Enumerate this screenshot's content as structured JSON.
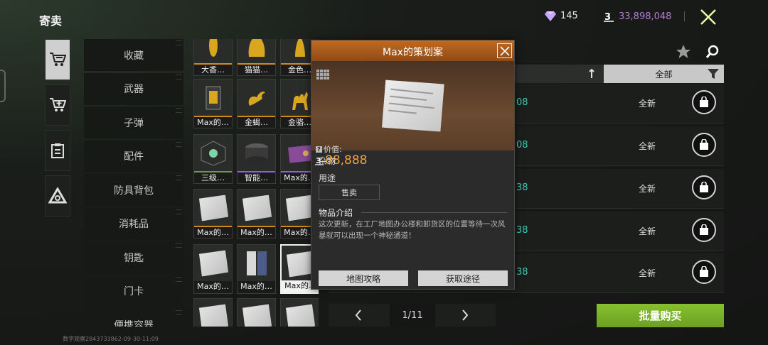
{
  "header": {
    "title": "寄卖",
    "gems": "145",
    "coins": "33,898,048"
  },
  "side_tabs": [
    {
      "icon": "cart-icon",
      "active": true
    },
    {
      "icon": "sell-cart-icon",
      "active": false
    },
    {
      "icon": "clipboard-icon",
      "active": false
    },
    {
      "icon": "triangle-icon",
      "active": false
    }
  ],
  "sub_categories": [
    "收藏",
    "武器",
    "子弹",
    "配件",
    "防具背包",
    "消耗品",
    "钥匙",
    "门卡",
    "便携容器"
  ],
  "grid_items": [
    {
      "name": "大香…",
      "rarity": "orange",
      "icon": "gold-statue-icon"
    },
    {
      "name": "猫猫…",
      "rarity": "orange",
      "icon": "gold-statue-icon"
    },
    {
      "name": "金色…",
      "rarity": "orange",
      "icon": "gold-statue-icon"
    },
    {
      "name": "Max的…",
      "rarity": "orange",
      "icon": "gold-card-icon"
    },
    {
      "name": "金蝎…",
      "rarity": "orange",
      "icon": "gold-scorpion-icon"
    },
    {
      "name": "金骆…",
      "rarity": "orange",
      "icon": "gold-camel-icon"
    },
    {
      "name": "三级…",
      "rarity": "green",
      "icon": "box-icon"
    },
    {
      "name": "智能…",
      "rarity": "purple",
      "icon": "tin-icon"
    },
    {
      "name": "Max的…",
      "rarity": "purple",
      "icon": "card-icon"
    },
    {
      "name": "Max的…",
      "rarity": "orange",
      "icon": "paper-icon"
    },
    {
      "name": "Max的…",
      "rarity": "orange",
      "icon": "paper-icon"
    },
    {
      "name": "Max的…",
      "rarity": "orange",
      "icon": "paper-icon"
    },
    {
      "name": "Max的…",
      "rarity": "none",
      "icon": "paper-icon"
    },
    {
      "name": "Max的…",
      "rarity": "none",
      "icon": "book-icon"
    },
    {
      "name": "Max的…",
      "rarity": "selected",
      "icon": "paper-icon"
    },
    {
      "name": "",
      "rarity": "none",
      "icon": "paper-icon"
    },
    {
      "name": "",
      "rarity": "none",
      "icon": "paper-icon"
    },
    {
      "name": "",
      "rarity": "none",
      "icon": "paper-icon"
    }
  ],
  "list": {
    "filter_label": "全部",
    "rows": [
      {
        "price_fragment": "08",
        "condition": "全新"
      },
      {
        "price_fragment": "08",
        "condition": "全新"
      },
      {
        "price_fragment": "38",
        "condition": "全新"
      },
      {
        "price_fragment": "38",
        "condition": "全新"
      },
      {
        "price_fragment": "38",
        "condition": "全新"
      }
    ]
  },
  "pager": {
    "page": "1/11"
  },
  "bulk_buy_label": "批量购买",
  "watermark": "数字观察2843733862-09-30-11:09",
  "detail": {
    "title": "Max的策划案",
    "price_label": "价值:",
    "price_value": "88,888",
    "category": "杂物",
    "usage_label": "用途",
    "usage_tag": "售卖",
    "intro_label": "物品介绍",
    "intro_text": "这次更新，在工厂地图办公楼和卸货区的位置等待一次风暴就可以出现一个神秘通道！",
    "button_map": "地图攻略",
    "button_source": "获取途径"
  },
  "colors": {
    "accent_orange": "#c06a22",
    "price_orange": "#f0a43a",
    "coin_purple": "#b77ad6",
    "teal_price": "#3ec9b0",
    "bulk_green": "#7cb22a"
  }
}
